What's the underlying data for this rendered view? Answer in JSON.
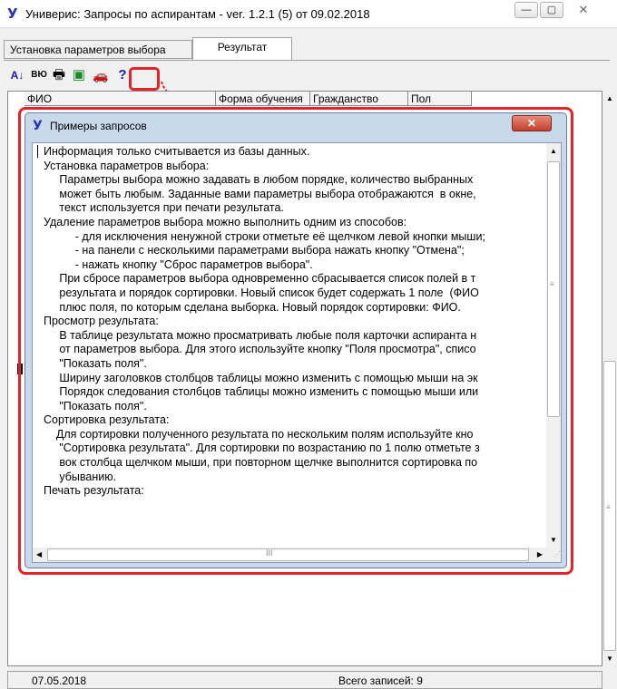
{
  "window": {
    "title": "Универис: Запросы по аспирантам  -  ver. 1.2.1 (5) от 09.02.2018",
    "icon": "У",
    "min_glyph": "—",
    "max_glyph": "▢",
    "close_glyph": "✕"
  },
  "tabs": [
    {
      "label": "Установка параметров выбора"
    },
    {
      "label": "Результат"
    }
  ],
  "toolbar": {
    "sort_glyph": "A↓",
    "grid_glyph": "ВЮ",
    "print_glyph": "🖶",
    "excel_glyph": "▣",
    "car_glyph": "🚗",
    "help_glyph": "?"
  },
  "table": {
    "columns": [
      "ФИО",
      "Форма обучения",
      "Гражданство",
      "Пол"
    ]
  },
  "dialog": {
    "icon": "У",
    "title": "Примеры запросов",
    "close_glyph": "✕",
    "text": "Информация только считывается из базы данных.\nУстановка параметров выбора:\n     Параметры выбора можно задавать в любом порядке, количество выбранных\n     может быть любым. Заданные вами параметры выбора отображаются  в окне,\n     текст используется при печати результата.\nУдаление параметров выбора можно выполнить одним из способов:\n          - для исключения ненужной строки отметьте её щелчком левой кнопки мыши;\n          - на панели с несколькими параметрами выбора нажать кнопку \"Отмена\";\n          - нажать кнопку \"Сброс параметров выбора\".\n     При сбросе параметров выбора одновременно сбрасывается список полей в т\n     результата и порядок сортировки. Новый список будет содержать 1 поле  (ФИО\n     плюс поля, по которым сделана выборка. Новый порядок сортировки: ФИО.\nПросмотр результата:\n     В таблице результата можно просматривать любые поля карточки аспиранта н\n     от параметров выбора. Для этого используйте кнопку \"Поля просмотра\", списо\n     \"Показать поля\".\n     Ширину заголовков столбцов таблицы можно изменить с помощью мыши на эк\n     Порядок следования столбцов таблицы можно изменить с помощью мыши или\n     \"Показать поля\".\nСортировка результата:\n    Для сортировки полученного результата по нескольким полям используйте кно\n     \"Сортировка результата\". Для сортировки по возрастанию по 1 полю отметьте з\n     вок столбца щелчком мыши, при повторном щелчке выполнится сортировка по\n     убыванию.\nПечать результата:"
  },
  "statusbar": {
    "date": "07.05.2018",
    "records": "Всего записей: 9"
  },
  "colors": {
    "highlight": "#e0252a",
    "brand": "#2b35b8"
  }
}
